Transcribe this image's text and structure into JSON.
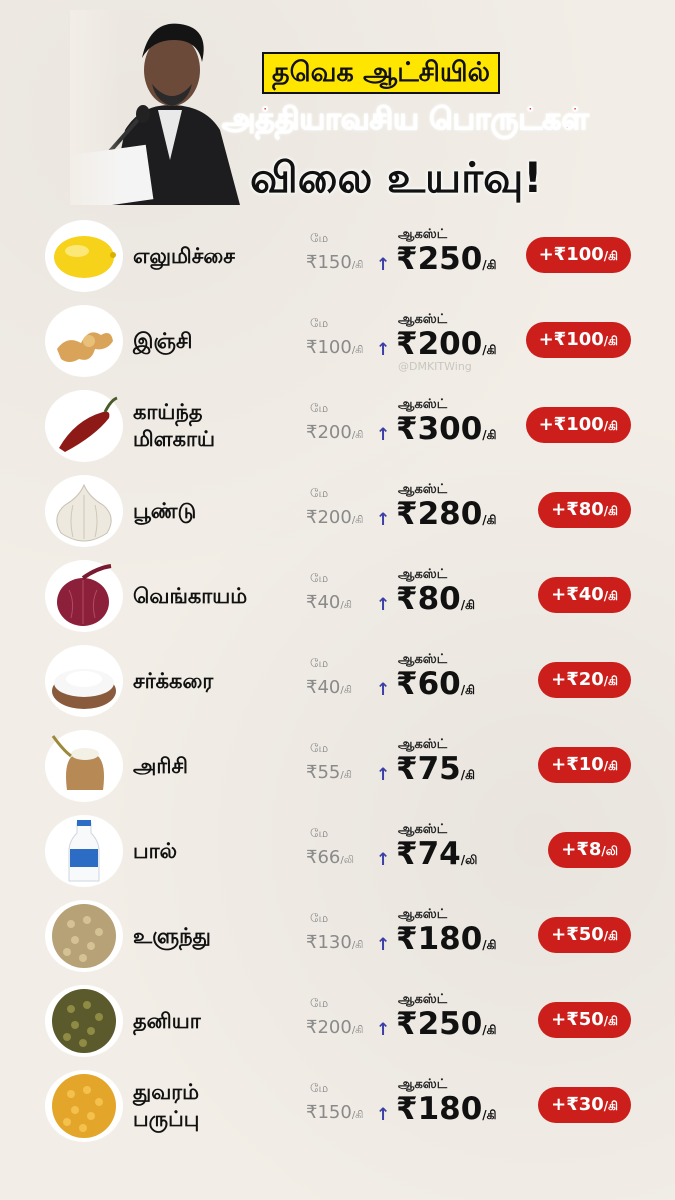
{
  "header": {
    "line1": "தவெக ஆட்சியில்",
    "line2": "அத்தியாவசிய பொருட்கள்",
    "line3": "விலை உயர்வு!"
  },
  "labels": {
    "old": "மே",
    "new": "ஆகஸ்ட்"
  },
  "watermark": "@DMKITWing",
  "colors": {
    "badge": "#cc1f1c",
    "highlight": "#ffe600",
    "title_red": "#d8171d",
    "arrow": "#3b3fa6"
  },
  "items": [
    {
      "name": "எலுமிச்சை",
      "icon": "lemon-icon",
      "old": "₹150",
      "old_unit": "/கி",
      "new": "₹250",
      "new_unit": "/கி",
      "diff": "+₹100",
      "diff_unit": "/கி"
    },
    {
      "name": "இஞ்சி",
      "icon": "ginger-icon",
      "old": "₹100",
      "old_unit": "/கி",
      "new": "₹200",
      "new_unit": "/கி",
      "diff": "+₹100",
      "diff_unit": "/கி"
    },
    {
      "name": "காய்ந்த மிளகாய்",
      "icon": "dried-chili-icon",
      "old": "₹200",
      "old_unit": "/கி",
      "new": "₹300",
      "new_unit": "/கி",
      "diff": "+₹100",
      "diff_unit": "/கி"
    },
    {
      "name": "பூண்டு",
      "icon": "garlic-icon",
      "old": "₹200",
      "old_unit": "/கி",
      "new": "₹280",
      "new_unit": "/கி",
      "diff": "+₹80",
      "diff_unit": "/கி"
    },
    {
      "name": "வெங்காயம்",
      "icon": "onion-icon",
      "old": "₹40",
      "old_unit": "/கி",
      "new": "₹80",
      "new_unit": "/கி",
      "diff": "+₹40",
      "diff_unit": "/கி"
    },
    {
      "name": "சர்க்கரை",
      "icon": "sugar-icon",
      "old": "₹40",
      "old_unit": "/கி",
      "new": "₹60",
      "new_unit": "/கி",
      "diff": "+₹20",
      "diff_unit": "/கி"
    },
    {
      "name": "அரிசி",
      "icon": "rice-sack-icon",
      "old": "₹55",
      "old_unit": "/கி",
      "new": "₹75",
      "new_unit": "/கி",
      "diff": "+₹10",
      "diff_unit": "/கி"
    },
    {
      "name": "பால்",
      "icon": "milk-bottle-icon",
      "old": "₹66",
      "old_unit": "/லி",
      "new": "₹74",
      "new_unit": "/லி",
      "diff": "+₹8",
      "diff_unit": "/லி"
    },
    {
      "name": "உளுந்து",
      "icon": "urad-dal-icon",
      "old": "₹130",
      "old_unit": "/கி",
      "new": "₹180",
      "new_unit": "/கி",
      "diff": "+₹50",
      "diff_unit": "/கி"
    },
    {
      "name": "தனியா",
      "icon": "coriander-seeds-icon",
      "old": "₹200",
      "old_unit": "/கி",
      "new": "₹250",
      "new_unit": "/கி",
      "diff": "+₹50",
      "diff_unit": "/கி"
    },
    {
      "name": "துவரம் பருப்பு",
      "icon": "toor-dal-icon",
      "old": "₹150",
      "old_unit": "/கி",
      "new": "₹180",
      "new_unit": "/கி",
      "diff": "+₹30",
      "diff_unit": "/கி"
    }
  ]
}
